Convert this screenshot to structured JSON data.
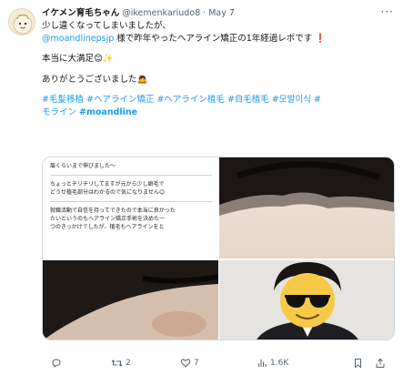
{
  "tweet": {
    "display_name": "イケメン育毛ちゃん",
    "handle": "@ikemenkariudo8",
    "separator": "·",
    "date": "May 7",
    "more_label": "···",
    "lines": [
      "少し違くなってしまいましたが、",
      "様で昨年やったヘアライン矯正の1年経過レポです"
    ],
    "mention": "@moandlinepsjp",
    "exclaim": "❗",
    "line3": "本当に大満足😊✨",
    "line4": "ありがとうございました🙇",
    "hashtags_line1": "#毛髪移植 #ヘアライン矯正 #ヘアライン植毛 #自毛植毛 #모발이식 #",
    "hashtags_line2_prefix": "モライン",
    "hashtags_line2_bold": "#moandline"
  },
  "media": {
    "text_card": {
      "section1": [
        "眉くらいまで伸びました～"
      ],
      "section2": [
        "ちょっとチリチリしてますが元から少し癖毛で",
        "どうせ植毛部分はわかるので気になりません😊"
      ],
      "section3": [
        "就職活動で自信を持ってできたので本当に良かった",
        "たいというのもヘアライン矯正手術を決めた一",
        "つのきっかけでしたが、植毛もヘアラインをと"
      ]
    }
  },
  "actions": {
    "reply_count": "",
    "retweet_count": "2",
    "like_count": "7",
    "views_count": "1.6K"
  },
  "colors": {
    "accent": "#1d9bf0",
    "muted": "#536471",
    "text": "#0f1419"
  }
}
